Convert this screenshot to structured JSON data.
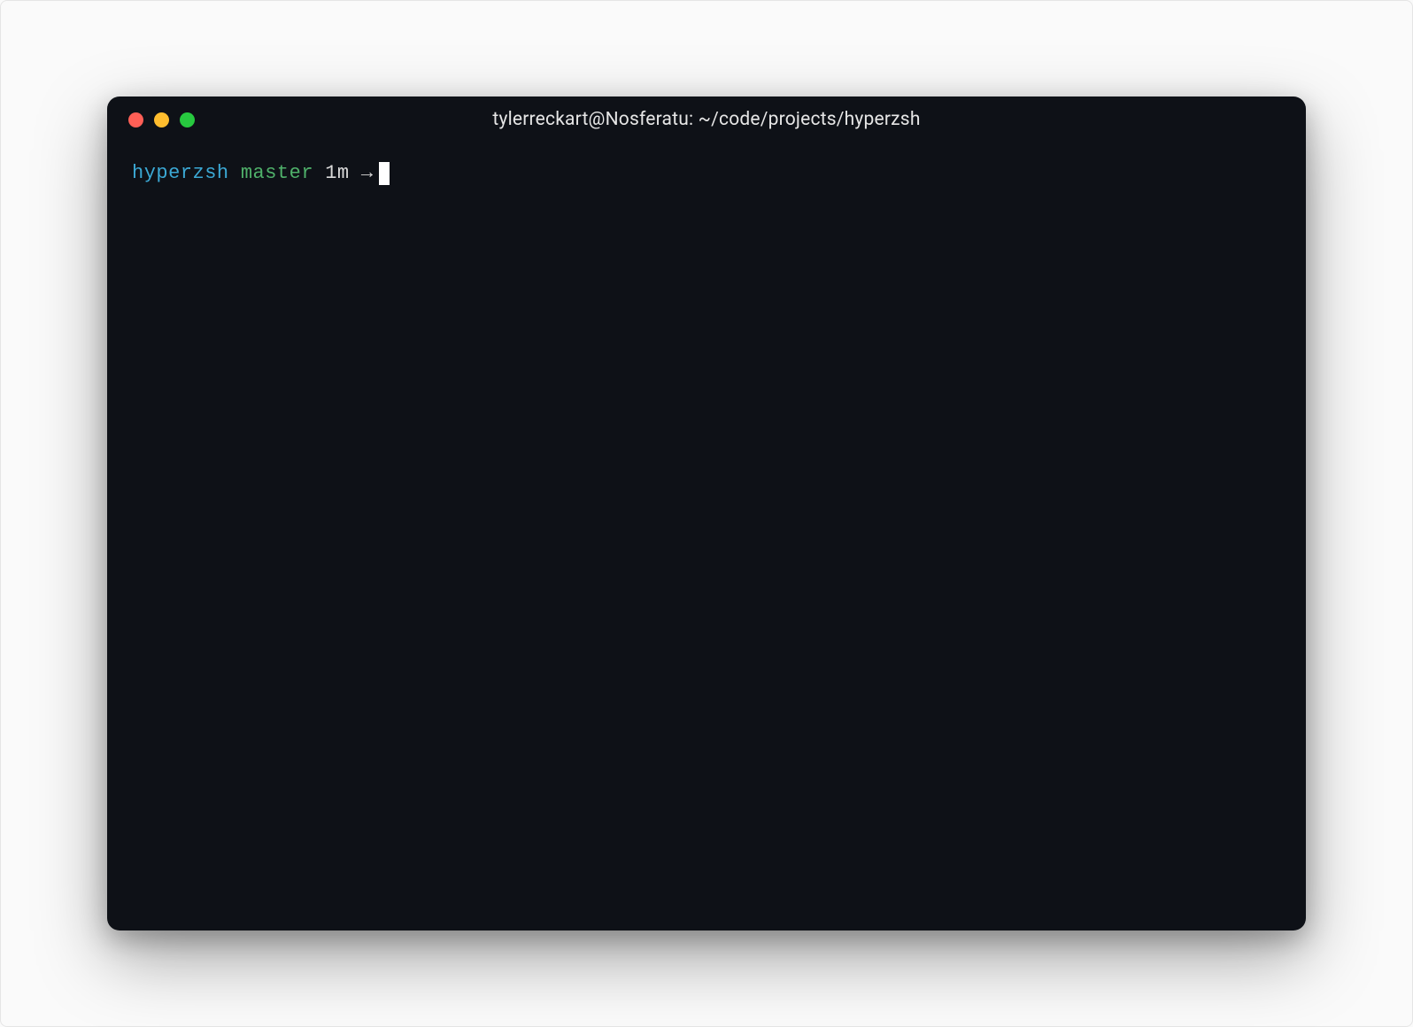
{
  "window": {
    "title": "tylerreckart@Nosferatu: ~/code/projects/hyperzsh"
  },
  "traffic_lights": {
    "red": "#ff5f56",
    "yellow": "#ffbd2e",
    "green": "#27c93f"
  },
  "prompt": {
    "directory": "hyperzsh",
    "branch": "master",
    "time": "1m",
    "arrow": "→"
  },
  "colors": {
    "background": "#0e1117",
    "directory": "#3ba8d4",
    "branch": "#4fb06a",
    "text": "#d8d8d8",
    "cursor": "#ffffff"
  }
}
